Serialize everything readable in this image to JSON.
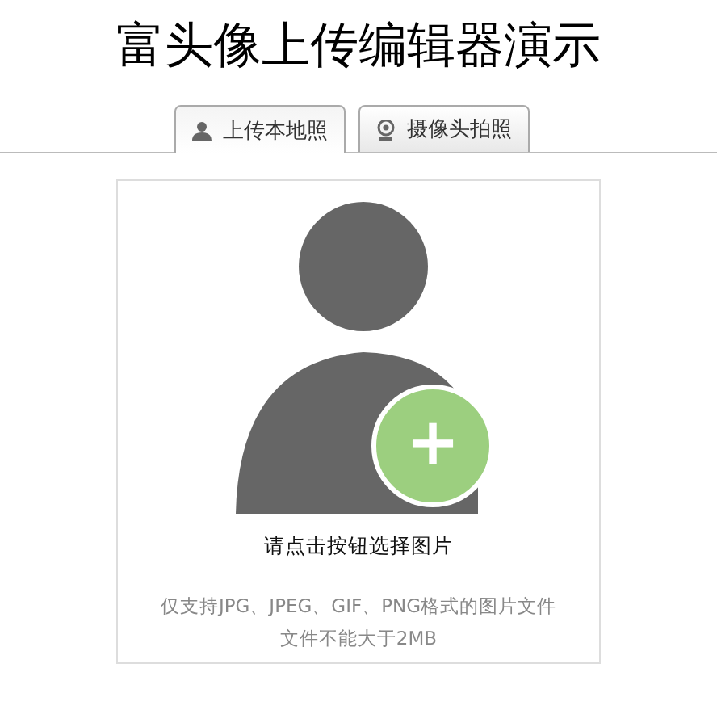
{
  "title": "富头像上传编辑器演示",
  "tabs": [
    {
      "label": "上传本地照",
      "kind": "person",
      "selected": true
    },
    {
      "label": "摄像头拍照",
      "kind": "camera",
      "selected": false
    }
  ],
  "upload": {
    "add_symbol": "+",
    "hint": "请点击按钮选择图片",
    "notes": [
      "仅支持JPG、JPEG、GIF、PNG格式的图片文件",
      "文件不能大于2MB"
    ]
  }
}
